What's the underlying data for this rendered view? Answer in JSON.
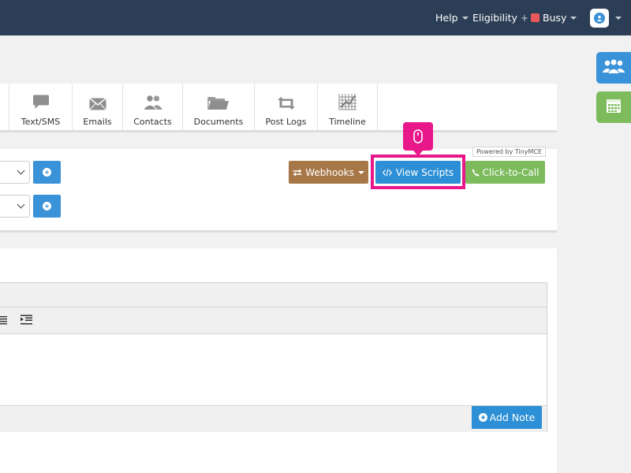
{
  "navbar": {
    "help": "Help",
    "eligibility": "Eligibility",
    "eligibility_plus": "+",
    "status": "Busy",
    "colors": {
      "background": "#2c3e55",
      "busy": "#e9585a"
    }
  },
  "tabs": [
    {
      "label": "Text/SMS",
      "icon": "chat-icon"
    },
    {
      "label": "Emails",
      "icon": "envelope-icon"
    },
    {
      "label": "Contacts",
      "icon": "users-icon"
    },
    {
      "label": "Documents",
      "icon": "folder-icon"
    },
    {
      "label": "Post Logs",
      "icon": "retweet-icon"
    },
    {
      "label": "Timeline",
      "icon": "timeline-grid-icon"
    }
  ],
  "actions": {
    "webhooks": "Webhooks",
    "view_scripts": "View Scripts",
    "click_to_call": "Click-to-Call",
    "colors": {
      "webhooks": "#a87748",
      "view_scripts": "#2d8fd5",
      "click_to_call": "#7dbb5d",
      "highlight": "#e8178a"
    }
  },
  "editor": {
    "powered_by": "Powered by TinyMCE"
  },
  "note": {
    "add_note": "Add Note"
  },
  "sidebar": {
    "users_icon": "users-icon",
    "calendar_icon": "calendar-icon"
  }
}
